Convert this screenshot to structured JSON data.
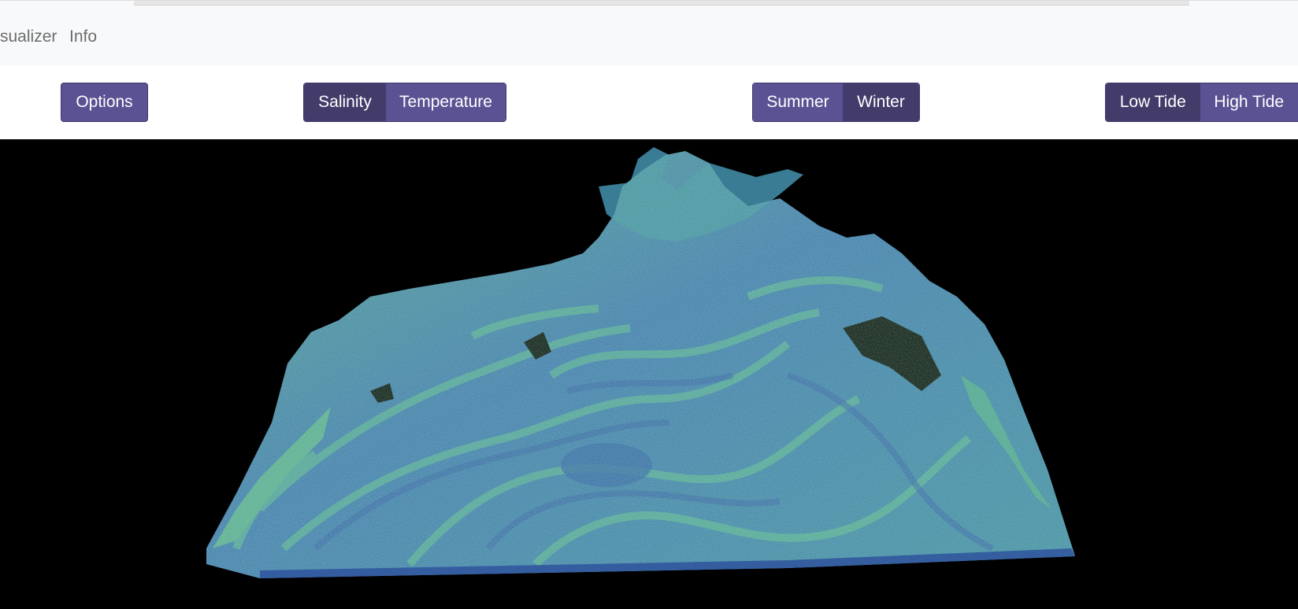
{
  "navbar": {
    "brand_partial": "sualizer",
    "info_label": "Info"
  },
  "controls": {
    "options_label": "Options",
    "variable_toggle": [
      {
        "label": "Salinity",
        "active": true
      },
      {
        "label": "Temperature",
        "active": false
      }
    ],
    "season_toggle": [
      {
        "label": "Summer",
        "active": false
      },
      {
        "label": "Winter",
        "active": true
      }
    ],
    "tide_toggle": [
      {
        "label": "Low Tide",
        "active": true
      },
      {
        "label": "High Tide",
        "active": false
      }
    ]
  },
  "colors": {
    "button": "#5b5294",
    "button_active": "#433c6a",
    "viz_background": "#000000",
    "volume_low": "#2a4fa3",
    "volume_high": "#5cbf7a"
  }
}
